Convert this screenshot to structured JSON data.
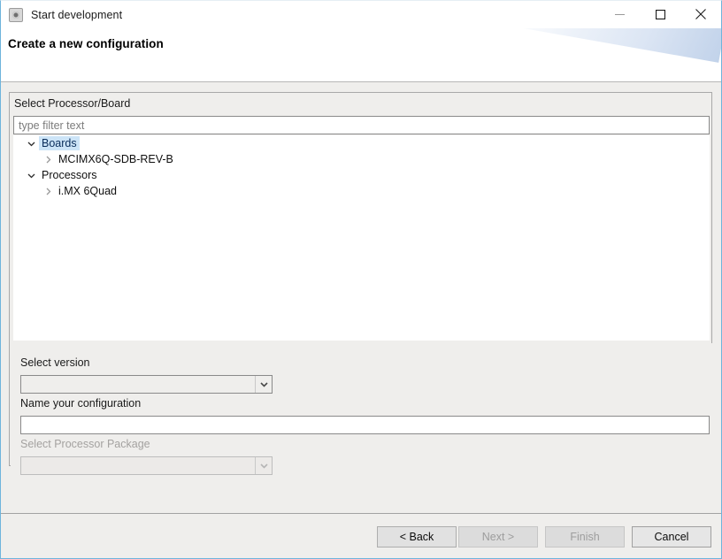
{
  "window": {
    "title": "Start development",
    "app_icon": "application-icon",
    "controls": {
      "minimize": "minimize-icon",
      "maximize": "maximize-icon",
      "close": "close-icon"
    }
  },
  "header": {
    "title": "Create a new configuration"
  },
  "group": {
    "label": "Select Processor/Board",
    "filter": {
      "value": "",
      "placeholder": "type filter text"
    },
    "tree": [
      {
        "label": "Boards",
        "level": 1,
        "expanded": true,
        "selected": true,
        "twisty": "chevron-down-icon"
      },
      {
        "label": "MCIMX6Q-SDB-REV-B",
        "level": 2,
        "expanded": false,
        "selected": false,
        "twisty": "chevron-right-icon"
      },
      {
        "label": "Processors",
        "level": 1,
        "expanded": true,
        "selected": false,
        "twisty": "chevron-down-icon"
      },
      {
        "label": "i.MX 6Quad",
        "level": 2,
        "expanded": false,
        "selected": false,
        "twisty": "chevron-right-icon"
      }
    ],
    "fields": {
      "select_version_label": "Select version",
      "select_version_value": "",
      "name_label": "Name your configuration",
      "name_value": "",
      "name_placeholder": "",
      "package_label": "Select Processor Package",
      "package_value": "",
      "package_disabled": true
    }
  },
  "footer": {
    "back": "< Back",
    "next": "Next >",
    "finish": "Finish",
    "cancel": "Cancel"
  },
  "colors": {
    "selection": "#cce4f7",
    "window_border": "#6eb4dc",
    "panel_bg": "#efeeec",
    "disabled_text": "#a4a2a0"
  }
}
